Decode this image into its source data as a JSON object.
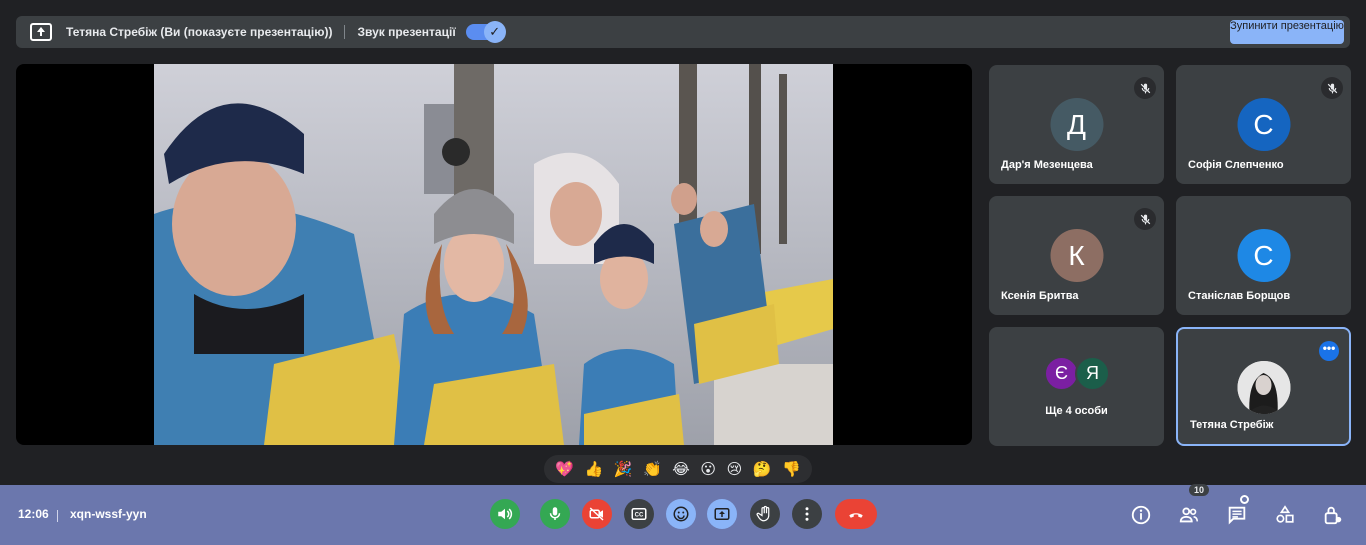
{
  "topbar": {
    "presenter": "Тетяна Стребіж (Ви (показуєте презентацію))",
    "sound_label": "Звук презентації",
    "sound_on": true,
    "stop_button": "Зупинити презентацію"
  },
  "participants": [
    {
      "name": "Дар'я Мезенцева",
      "initial": "Д",
      "color": "#455a64",
      "muted": true
    },
    {
      "name": "Софія Слепченко",
      "initial": "С",
      "color": "#1565c0",
      "muted": true
    },
    {
      "name": "Ксенія Бритва",
      "initial": "К",
      "color": "#8d6e63",
      "muted": true
    },
    {
      "name": "Станіслав Борщов",
      "initial": "С",
      "color": "#1e88e5",
      "muted": false
    }
  ],
  "others": {
    "label": "Ще 4 особи",
    "avatars": [
      {
        "initial": "Є",
        "color": "#7b1fa2"
      },
      {
        "initial": "Я",
        "color": "#1b5e4a"
      }
    ]
  },
  "self": {
    "name": "Тетяна Стребіж"
  },
  "reactions": [
    "💖",
    "👍",
    "🎉",
    "👏",
    "😂",
    "😮",
    "😢",
    "🤔",
    "👎"
  ],
  "bottombar": {
    "time": "12:06",
    "meeting_code": "xqn-wssf-yyn",
    "participant_count": "10"
  },
  "colors": {
    "accent": "#8ab4f8",
    "bottombar": "#6b77ad",
    "end_call": "#ea4335",
    "sound_button": "#34a853"
  }
}
